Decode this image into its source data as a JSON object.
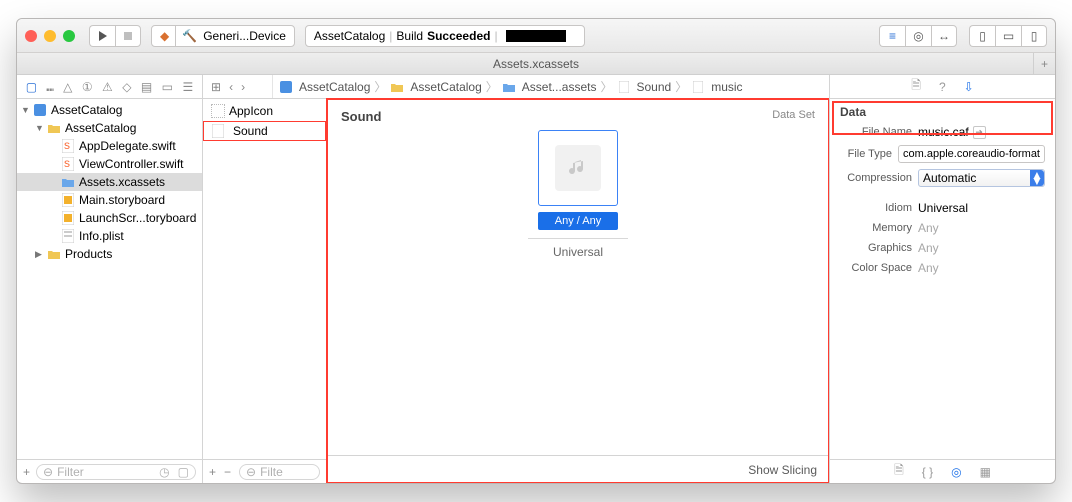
{
  "toolbar": {
    "scheme_target": "Generi...Device",
    "status_project": "AssetCatalog",
    "status_action": "Build",
    "status_result": "Succeeded"
  },
  "tab": {
    "title": "Assets.xcassets"
  },
  "navigator": {
    "project": "AssetCatalog",
    "group": "AssetCatalog",
    "files": {
      "appdelegate": "AppDelegate.swift",
      "viewcontroller": "ViewController.swift",
      "assets": "Assets.xcassets",
      "mainstoryboard": "Main.storyboard",
      "launchstoryboard": "LaunchScr...toryboard",
      "infoplist": "Info.plist"
    },
    "products": "Products",
    "filter_placeholder": "Filter"
  },
  "breadcrumbs": {
    "b1": "AssetCatalog",
    "b2": "AssetCatalog",
    "b3": "Asset...assets",
    "b4": "Sound",
    "b5": "music"
  },
  "outline": {
    "item1": "AppIcon",
    "item2": "Sound",
    "filter_placeholder": "Filte"
  },
  "canvas": {
    "title": "Sound",
    "type": "Data Set",
    "slot_label": "Any / Any",
    "caption": "Universal",
    "footer": "Show Slicing"
  },
  "inspector": {
    "section": "Data",
    "filename_label": "File Name",
    "filename_value": "music.caf",
    "filetype_label": "File Type",
    "filetype_value": "com.apple.coreaudio-format",
    "compression_label": "Compression",
    "compression_value": "Automatic",
    "idiom_label": "Idiom",
    "idiom_value": "Universal",
    "memory_label": "Memory",
    "memory_value": "Any",
    "graphics_label": "Graphics",
    "graphics_value": "Any",
    "colorspace_label": "Color Space",
    "colorspace_value": "Any"
  }
}
